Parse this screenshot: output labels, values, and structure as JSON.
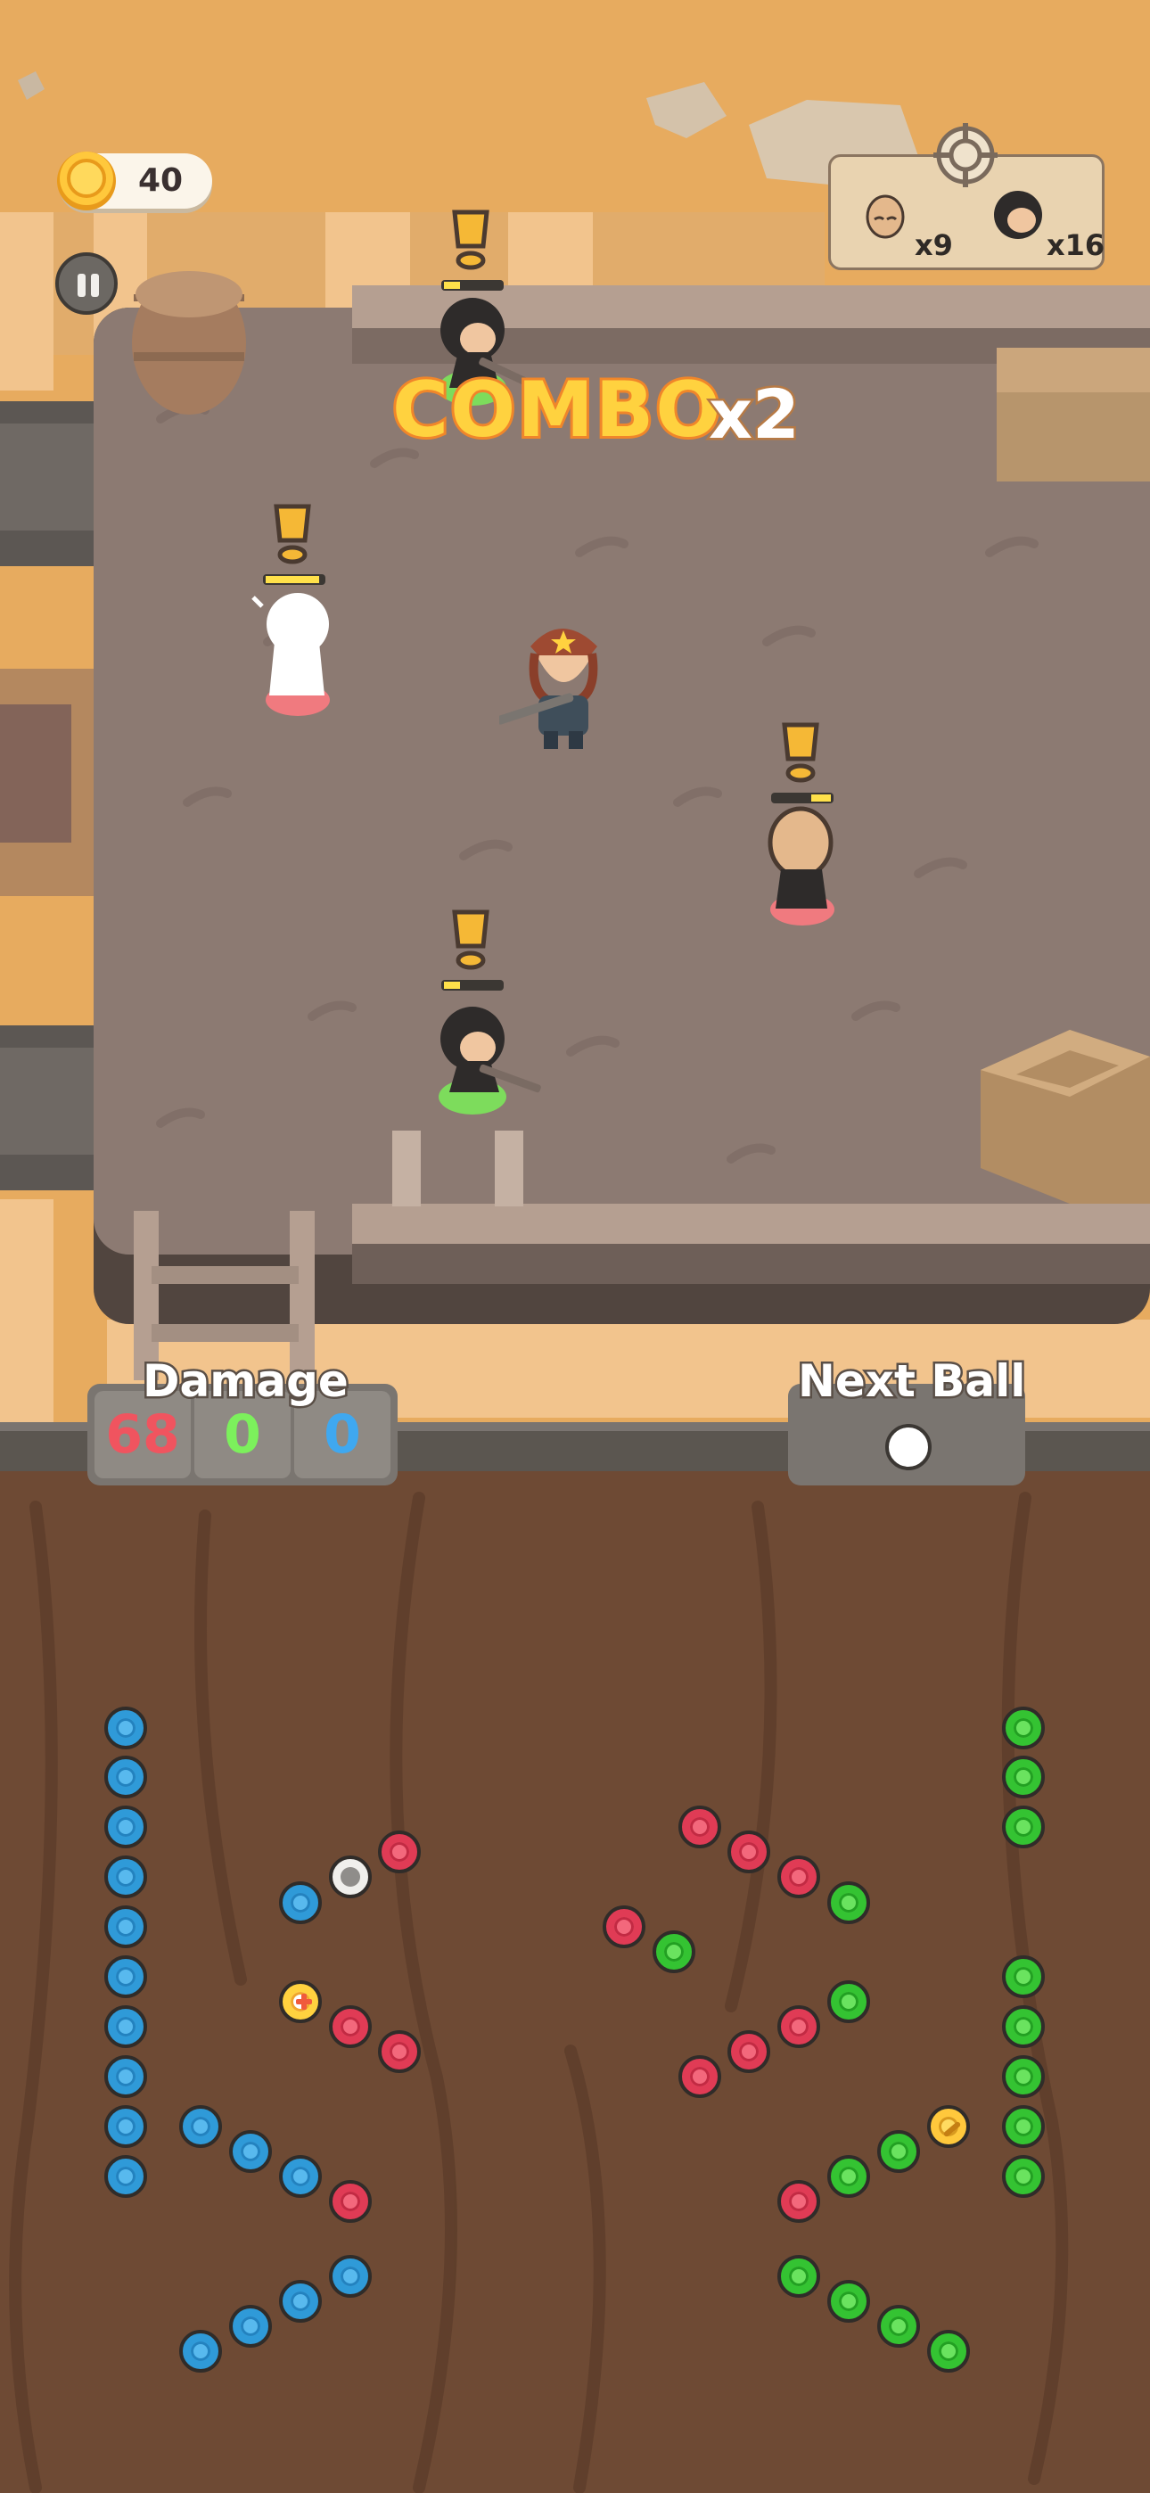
{
  "hud": {
    "coins": "40",
    "pause_icon": "pause-icon",
    "targets": [
      {
        "enemy": "bald-bandit",
        "count": "x9"
      },
      {
        "enemy": "hooded-gunman",
        "count": "x16"
      }
    ]
  },
  "combo": {
    "label": "COMBO",
    "multiplier": "x2"
  },
  "damage_panel": {
    "title": "Damage",
    "red": "68",
    "green": "0",
    "blue": "0"
  },
  "next_ball_panel": {
    "title": "Next Ball",
    "ball_color": "#ffffff"
  },
  "characters": [
    {
      "name": "hooded-gunman",
      "ring": "green",
      "alert": true
    },
    {
      "name": "hit-enemy-flash",
      "ring": "red",
      "alert": true
    },
    {
      "name": "sheriff-player",
      "ring": "none",
      "alert": false
    },
    {
      "name": "bald-bandit",
      "ring": "red",
      "alert": true
    },
    {
      "name": "hooded-gunman",
      "ring": "green",
      "alert": true
    }
  ],
  "colors": {
    "red": "#e03b55",
    "green": "#34c332",
    "blue": "#2f9ad8",
    "coin": "#ffc83c",
    "combo": "#ffd23f"
  }
}
